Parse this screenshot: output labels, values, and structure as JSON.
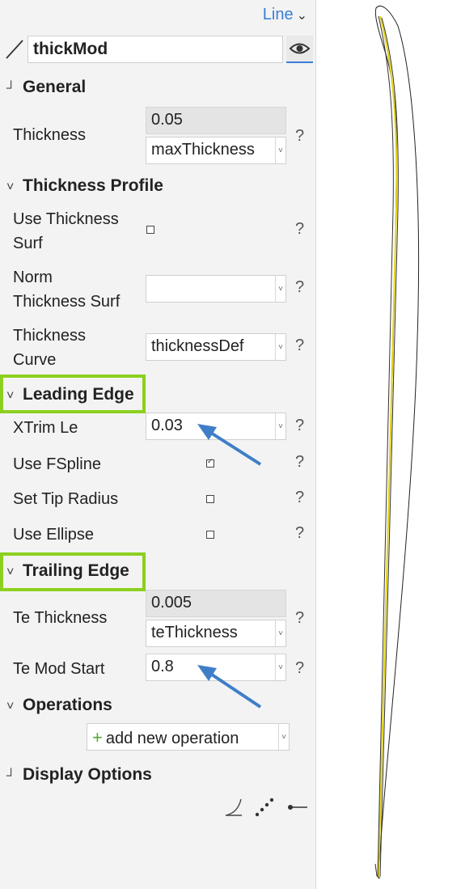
{
  "header": {
    "type_label": "Line",
    "name": "thickMod"
  },
  "sections": {
    "general": {
      "title": "General",
      "toggle": "┘"
    },
    "thickness_profile": {
      "title": "Thickness Profile",
      "toggle": "˅"
    },
    "leading_edge": {
      "title": "Leading Edge",
      "toggle": "˅"
    },
    "trailing_edge": {
      "title": "Trailing Edge",
      "toggle": "˅"
    },
    "operations": {
      "title": "Operations",
      "toggle": "˅"
    },
    "display_options": {
      "title": "Display Options",
      "toggle": "┘"
    }
  },
  "general": {
    "thickness": {
      "label": "Thickness",
      "value": "0.05",
      "select": "maxThickness"
    }
  },
  "thickness_profile": {
    "use_surf": {
      "label_line1": "Use Thickness",
      "label_line2": "Surf",
      "checked": false
    },
    "norm_surf": {
      "label_line1": "Norm",
      "label_line2": "Thickness Surf",
      "select": ""
    },
    "curve": {
      "label_line1": "Thickness",
      "label_line2": "Curve",
      "select": "thicknessDef"
    }
  },
  "leading_edge": {
    "xtrim": {
      "label": "XTrim Le",
      "value": "0.03"
    },
    "use_fspline": {
      "label": "Use FSpline",
      "checked": true
    },
    "set_tip_radius": {
      "label": "Set Tip Radius",
      "checked": false
    },
    "use_ellipse": {
      "label": "Use Ellipse",
      "checked": false
    }
  },
  "trailing_edge": {
    "te_thickness": {
      "label": "Te Thickness",
      "value": "0.005",
      "select": "teThickness"
    },
    "te_mod_start": {
      "label": "Te Mod Start",
      "value": "0.8"
    }
  },
  "operations": {
    "add_label": "add new operation"
  },
  "help_glyph": "?",
  "colors": {
    "accent": "#3b7dd8",
    "highlight": "#8cd01f",
    "arrow": "#3f7ec8",
    "curve_yellow": "#e3d21a"
  }
}
